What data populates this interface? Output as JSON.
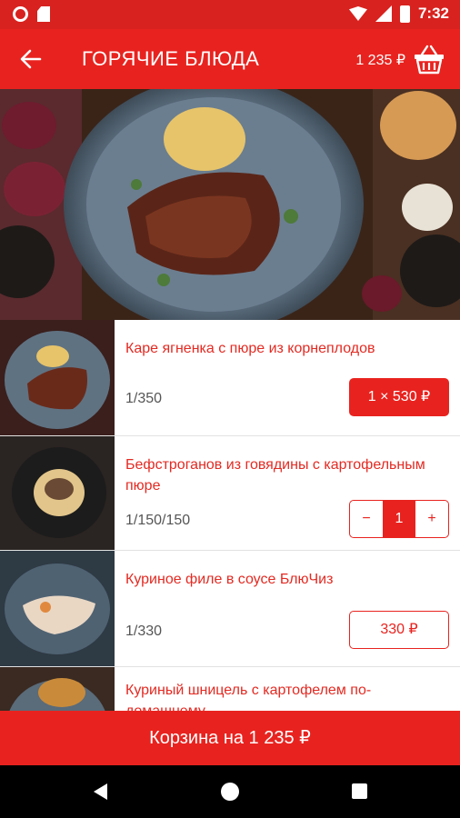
{
  "status_bar": {
    "time": "7:32"
  },
  "app_bar": {
    "title": "ГОРЯЧИЕ БЛЮДА",
    "cart_total": "1 235 ₽"
  },
  "items": [
    {
      "name": "Каре ягненка с пюре из корнеплодов",
      "weight": "1/350",
      "button": "1 × 530 ₽"
    },
    {
      "name": "Бефстроганов из говядины с картофельным пюре",
      "weight": "1/150/150",
      "stepper_minus": "−",
      "quantity": "1",
      "stepper_plus": "+"
    },
    {
      "name": "Куриное филе в соусе БлюЧиз",
      "weight": "1/330",
      "button": "330 ₽"
    },
    {
      "name": "Куриный шницель с картофелем по-домашнему",
      "weight": "",
      "button": ""
    }
  ],
  "cart_button": "Корзина на 1 235 ₽",
  "colors": {
    "accent": "#e8231f",
    "status_bar": "#d8221f",
    "dish_name": "#e32a22"
  },
  "icons": [
    "back-arrow-icon",
    "basket-icon",
    "wifi-icon",
    "signal-icon",
    "battery-icon",
    "nav-back-icon",
    "nav-home-icon",
    "nav-recents-icon"
  ]
}
